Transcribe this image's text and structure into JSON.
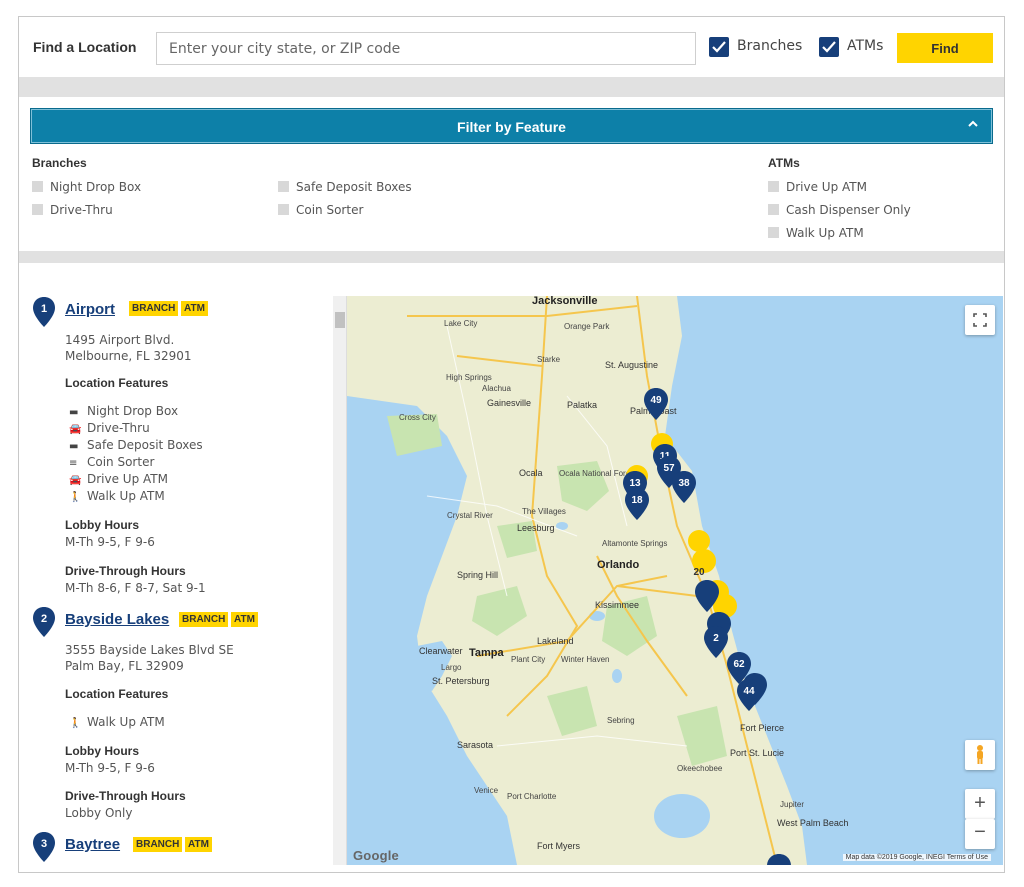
{
  "search": {
    "label": "Find a Location",
    "placeholder": "Enter your city state, or ZIP code",
    "branches_label": "Branches",
    "branches_checked": true,
    "atms_label": "ATMs",
    "atms_checked": true,
    "find_label": "Find"
  },
  "filter": {
    "title": "Filter by Feature",
    "branches_heading": "Branches",
    "atms_heading": "ATMs",
    "branch_col1": [
      "Night Drop Box",
      "Drive-Thru"
    ],
    "branch_col2": [
      "Safe Deposit Boxes",
      "Coin Sorter"
    ],
    "atm_options": [
      "Drive Up ATM",
      "Cash Dispenser Only",
      "Walk Up ATM"
    ]
  },
  "colors": {
    "navy": "#173f7a",
    "yellow": "#ffd400",
    "teal": "#0d80a8"
  },
  "locations": [
    {
      "number": "1",
      "name": "Airport",
      "badges": [
        "BRANCH",
        "ATM"
      ],
      "address1": "1495 Airport Blvd.",
      "address2": "Melbourne, FL 32901",
      "features_heading": "Location Features",
      "features": [
        {
          "icon": "briefcase-icon",
          "label": "Night Drop Box"
        },
        {
          "icon": "car-icon",
          "label": "Drive-Thru"
        },
        {
          "icon": "safe-box-icon",
          "label": "Safe Deposit Boxes"
        },
        {
          "icon": "coins-icon",
          "label": "Coin Sorter"
        },
        {
          "icon": "car-icon",
          "label": "Drive Up ATM"
        },
        {
          "icon": "walking-person-icon",
          "label": "Walk Up ATM"
        }
      ],
      "lobby_heading": "Lobby Hours",
      "lobby_hours": "M-Th 9-5, F 9-6",
      "drive_heading": "Drive-Through Hours",
      "drive_hours": "M-Th 8-6, F 8-7, Sat 9-1"
    },
    {
      "number": "2",
      "name": "Bayside Lakes",
      "badges": [
        "BRANCH",
        "ATM"
      ],
      "address1": "3555 Bayside Lakes Blvd SE",
      "address2": "Palm Bay, FL 32909",
      "features_heading": "Location Features",
      "features": [
        {
          "icon": "walking-person-icon",
          "label": "Walk Up ATM"
        }
      ],
      "lobby_heading": "Lobby Hours",
      "lobby_hours": "M-Th 9-5, F 9-6",
      "drive_heading": "Drive-Through Hours",
      "drive_hours": "Lobby Only"
    },
    {
      "number": "3",
      "name": "Baytree",
      "badges": [
        "BRANCH",
        "ATM"
      ]
    }
  ],
  "map": {
    "cities": [
      "Jacksonville",
      "Orlando",
      "Tampa",
      "Lakeland",
      "Kissimmee",
      "St. Augustine",
      "Gainesville",
      "Palatka",
      "Ocala",
      "Leesburg",
      "The Villages",
      "Spring Hill",
      "Clearwater",
      "St. Petersburg",
      "Largo",
      "Plant City",
      "Winter Haven",
      "Sarasota",
      "Sebring",
      "Fort Pierce",
      "Port St. Lucie",
      "Okeechobee",
      "Jupiter",
      "West Palm Beach",
      "Fort Myers",
      "Port Charlotte",
      "Venice",
      "Lake City",
      "Orange Park",
      "Starke",
      "High Springs",
      "Alachua",
      "Cross City",
      "Crystal River",
      "Altamonte Springs",
      "Palm Coast",
      "Ocala National Forest"
    ],
    "markers": [
      "49",
      "11",
      "57",
      "38",
      "13",
      "18",
      "20",
      "2",
      "62",
      "44"
    ],
    "google_logo": "Google",
    "attribution": "Map data ©2019 Google, INEGI   Terms of Use"
  }
}
